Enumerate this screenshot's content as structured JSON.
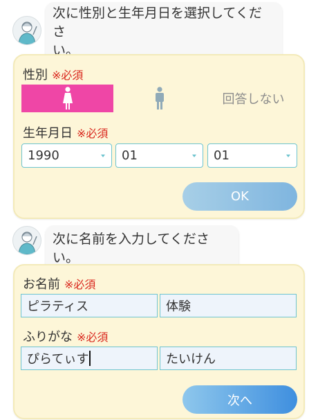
{
  "chat": {
    "message1": "次に性別と生年月日を選択してください。",
    "message1_line1": "次に性別と生年月日を選択してくださ",
    "message1_line2": "い。",
    "message2": "次に名前を入力してください。"
  },
  "profile_form": {
    "gender_label": "性別",
    "required_mark": "※必須",
    "gender_options": {
      "female": "female",
      "male": "male",
      "none": "回答しない"
    },
    "selected_gender": "female",
    "birthdate_label": "生年月日",
    "year": "1990",
    "month": "01",
    "day": "01",
    "ok_label": "OK"
  },
  "name_form": {
    "name_label": "お名前",
    "required_mark": "※必須",
    "last_name": "ピラティス",
    "first_name": "体験",
    "kana_label": "ふりがな",
    "last_name_kana": "ぴらてぃす",
    "first_name_kana": "たいけん",
    "next_label": "次へ"
  },
  "colors": {
    "accent_pink": "#ef46a6",
    "card_bg": "#fdf6d8",
    "required_red": "#d9261c",
    "input_border": "#6ec4cf"
  },
  "icons": {
    "avatar": "operator-avatar-icon",
    "female": "female-icon",
    "male": "male-icon",
    "caret": "chevron-down-icon"
  }
}
